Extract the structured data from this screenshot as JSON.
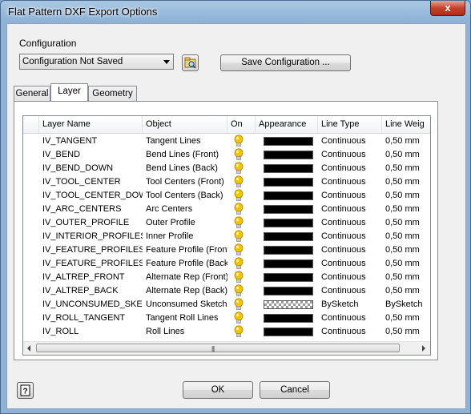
{
  "window": {
    "title": "Flat Pattern DXF Export Options",
    "close_label": "x"
  },
  "configuration": {
    "label": "Configuration",
    "selected": "Configuration Not Saved",
    "save_label": "Save Configuration ..."
  },
  "tabs": [
    {
      "label": "General",
      "active": false
    },
    {
      "label": "Layer",
      "active": true
    },
    {
      "label": "Geometry",
      "active": false
    }
  ],
  "table": {
    "columns": [
      "Layer Name",
      "Object",
      "On",
      "Appearance",
      "Line Type",
      "Line Weig"
    ],
    "rows": [
      {
        "layer": "IV_TANGENT",
        "object": "Tangent Lines",
        "appearance": "solid",
        "line_type": "Continuous",
        "line_weight": "0,50 mm"
      },
      {
        "layer": "IV_BEND",
        "object": "Bend Lines (Front)",
        "appearance": "solid",
        "line_type": "Continuous",
        "line_weight": "0,50 mm"
      },
      {
        "layer": "IV_BEND_DOWN",
        "object": "Bend Lines (Back)",
        "appearance": "solid",
        "line_type": "Continuous",
        "line_weight": "0,50 mm"
      },
      {
        "layer": "IV_TOOL_CENTER",
        "object": "Tool Centers (Front)",
        "appearance": "solid",
        "line_type": "Continuous",
        "line_weight": "0,50 mm"
      },
      {
        "layer": "IV_TOOL_CENTER_DOWN",
        "object": "Tool Centers (Back)",
        "appearance": "solid",
        "line_type": "Continuous",
        "line_weight": "0,50 mm"
      },
      {
        "layer": "IV_ARC_CENTERS",
        "object": "Arc Centers",
        "appearance": "solid",
        "line_type": "Continuous",
        "line_weight": "0,50 mm"
      },
      {
        "layer": "IV_OUTER_PROFILE",
        "object": "Outer Profile",
        "appearance": "solid",
        "line_type": "Continuous",
        "line_weight": "0,50 mm"
      },
      {
        "layer": "IV_INTERIOR_PROFILES",
        "object": "Inner Profile",
        "appearance": "solid",
        "line_type": "Continuous",
        "line_weight": "0,50 mm"
      },
      {
        "layer": "IV_FEATURE_PROFILES",
        "object": "Feature Profile (Front)",
        "appearance": "solid",
        "line_type": "Continuous",
        "line_weight": "0,50 mm"
      },
      {
        "layer": "IV_FEATURE_PROFILES_DOWN",
        "object": "Feature Profile (Back)",
        "appearance": "solid",
        "line_type": "Continuous",
        "line_weight": "0,50 mm"
      },
      {
        "layer": "IV_ALTREP_FRONT",
        "object": "Alternate Rep (Front)",
        "appearance": "solid",
        "line_type": "Continuous",
        "line_weight": "0,50 mm"
      },
      {
        "layer": "IV_ALTREP_BACK",
        "object": "Alternate Rep (Back)",
        "appearance": "solid",
        "line_type": "Continuous",
        "line_weight": "0,50 mm"
      },
      {
        "layer": "IV_UNCONSUMED_SKETCHES",
        "object": "Unconsumed Sketches",
        "appearance": "bysketch",
        "line_type": "BySketch",
        "line_weight": "BySketch"
      },
      {
        "layer": "IV_ROLL_TANGENT",
        "object": "Tangent Roll Lines",
        "appearance": "solid",
        "line_type": "Continuous",
        "line_weight": "0,50 mm"
      },
      {
        "layer": "IV_ROLL",
        "object": "Roll Lines",
        "appearance": "solid",
        "line_type": "Continuous",
        "line_weight": "0,50 mm"
      }
    ]
  },
  "buttons": {
    "ok": "OK",
    "cancel": "Cancel",
    "help": "?"
  },
  "colors": {
    "swatch": "#000000",
    "bulb": "#f5c400",
    "titlebar": "#a9c7e3",
    "close": "#c5412a"
  },
  "icons": {
    "on": "lightbulb-icon",
    "config_browse": "folder-icon",
    "help": "help-icon"
  }
}
